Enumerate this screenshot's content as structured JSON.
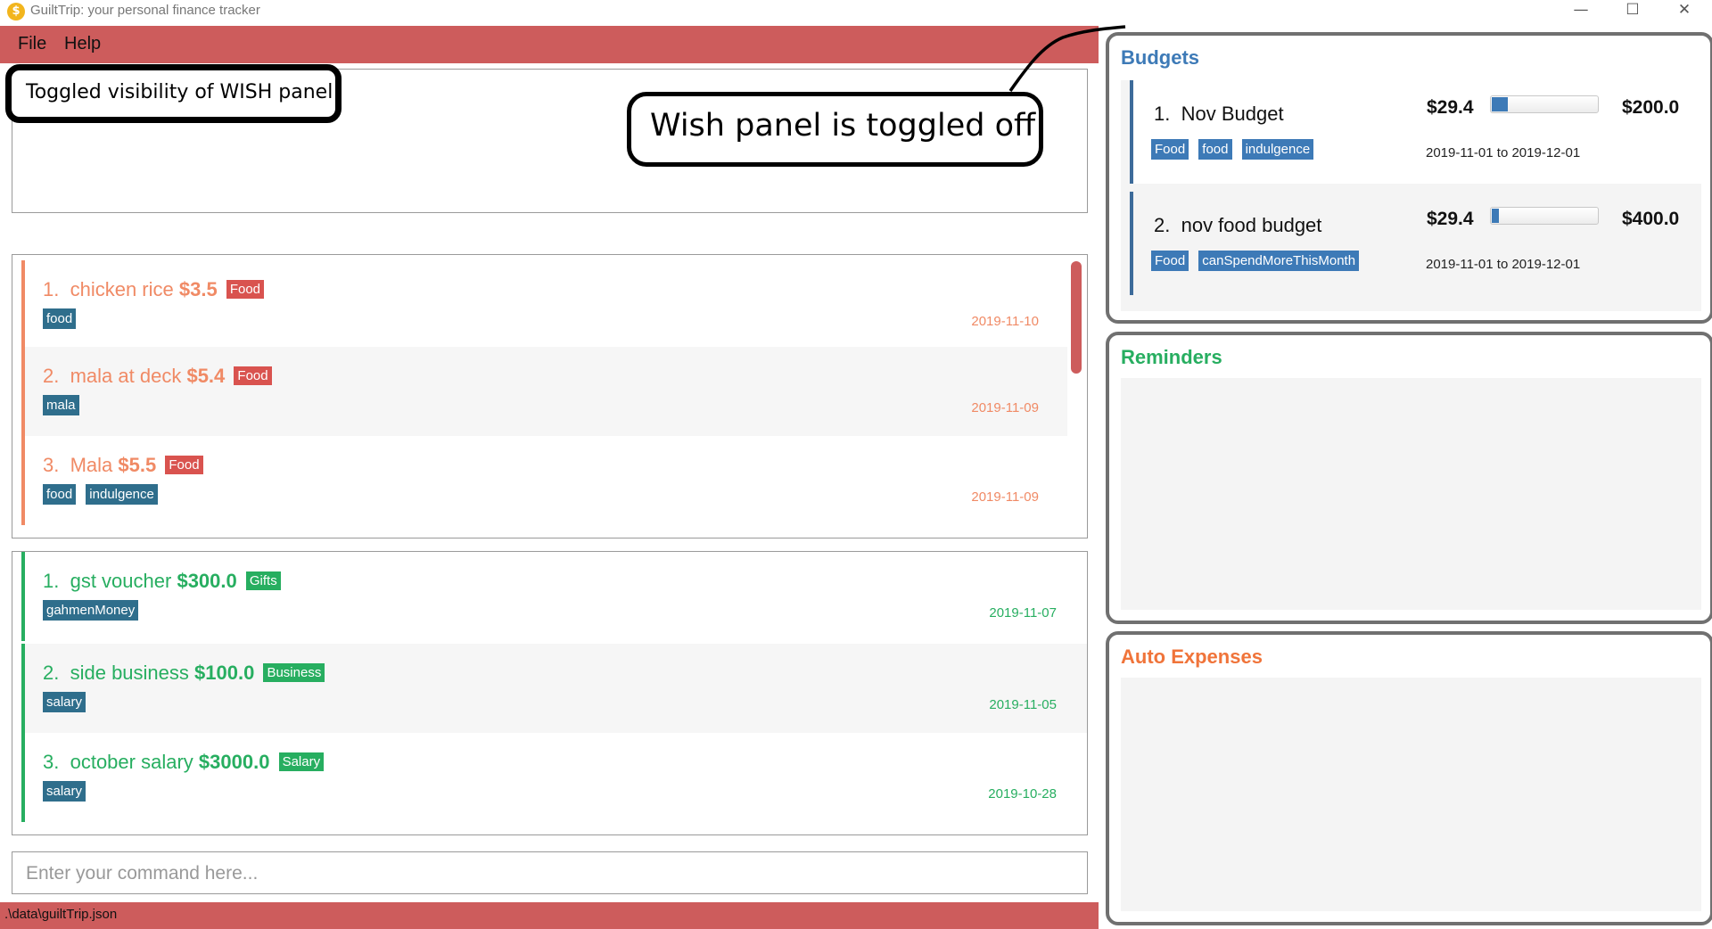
{
  "window": {
    "title": "GuiltTrip: your personal finance tracker",
    "app_icon": "coin-icon",
    "controls": [
      "minimize-icon",
      "maximize-icon",
      "close-icon"
    ],
    "minimize_glyph": "—",
    "maximize_glyph": "☐",
    "close_glyph": "✕"
  },
  "menu": {
    "file": "File",
    "help": "Help"
  },
  "result": {
    "message": "Toggled visibility of WISH panel",
    "annotation": "Wish panel is toggled off"
  },
  "expenses": [
    {
      "index": "1.",
      "name": "chicken rice",
      "amount": "$3.5",
      "category": "Food",
      "tags": [
        "food"
      ],
      "date": "2019-11-10"
    },
    {
      "index": "2.",
      "name": "mala at deck",
      "amount": "$5.4",
      "category": "Food",
      "tags": [
        "mala"
      ],
      "date": "2019-11-09"
    },
    {
      "index": "3.",
      "name": "Mala",
      "amount": "$5.5",
      "category": "Food",
      "tags": [
        "food",
        "indulgence"
      ],
      "date": "2019-11-09"
    }
  ],
  "incomes": [
    {
      "index": "1.",
      "name": "gst voucher",
      "amount": "$300.0",
      "category": "Gifts",
      "tags": [
        "gahmenMoney"
      ],
      "date": "2019-11-07"
    },
    {
      "index": "2.",
      "name": "side business",
      "amount": "$100.0",
      "category": "Business",
      "tags": [
        "salary"
      ],
      "date": "2019-11-05"
    },
    {
      "index": "3.",
      "name": "october salary",
      "amount": "$3000.0",
      "category": "Salary",
      "tags": [
        "salary"
      ],
      "date": "2019-10-28"
    }
  ],
  "command": {
    "placeholder": "Enter your command here..."
  },
  "status": {
    "file_path": ".\\data\\guiltTrip.json"
  },
  "budgets": {
    "title": "Budgets",
    "items": [
      {
        "index": "1.",
        "name": "Nov Budget",
        "tags": [
          "Food",
          "food",
          "indulgence"
        ],
        "spent": "$29.4",
        "total": "$200.0",
        "progress": 0.147,
        "range": "2019-11-01 to 2019-12-01"
      },
      {
        "index": "2.",
        "name": "nov food budget",
        "tags": [
          "Food",
          "canSpendMoreThisMonth"
        ],
        "spent": "$29.4",
        "total": "$400.0",
        "progress": 0.0735,
        "range": "2019-11-01 to 2019-12-01"
      }
    ]
  },
  "reminders": {
    "title": "Reminders"
  },
  "auto_expenses": {
    "title": "Auto Expenses"
  },
  "colors": {
    "menu_bar": "#cd5c5c",
    "expense_text": "#f08a65",
    "expense_category": "#d9534f",
    "income_text": "#27ae60",
    "tag": "#2f6e8c",
    "budget_title": "#3d7ab7",
    "reminders_title": "#27ae60",
    "auto_expenses_title": "#f0743a"
  }
}
